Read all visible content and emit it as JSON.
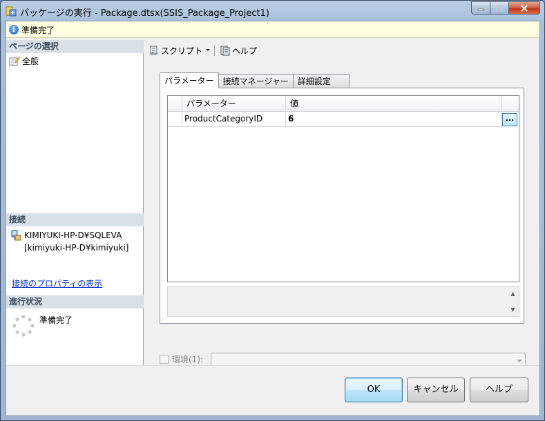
{
  "window": {
    "title": "パッケージの実行 - Package.dtsx(SSIS_Package_Project1)"
  },
  "status": {
    "text": "準備完了"
  },
  "left": {
    "page_select_header": "ページの選択",
    "page_item": "全般",
    "connection_header": "接続",
    "connection_server": "KIMIYUKI-HP-D¥SQLEVA",
    "connection_user": "[kimiyuki-HP-D¥kimiyuki]",
    "connection_link": "接続のプロパティの表示",
    "progress_header": "進行状況",
    "progress_text": "準備完了"
  },
  "toolbar": {
    "script_label": "スクリプト",
    "help_label": "ヘルプ"
  },
  "tabs": [
    {
      "label": "パラメーター",
      "active": true
    },
    {
      "label": "接続マネージャー",
      "active": false
    },
    {
      "label": "詳細設定",
      "active": false
    }
  ],
  "grid": {
    "columns": [
      "パラメーター",
      "値"
    ],
    "rows": [
      {
        "parameter": "ProductCategoryID",
        "value": "6",
        "button": "..."
      }
    ]
  },
  "environment": {
    "label": "環境(1):",
    "value": ""
  },
  "buttons": {
    "ok": "OK",
    "cancel": "キャンセル",
    "help": "ヘルプ"
  }
}
